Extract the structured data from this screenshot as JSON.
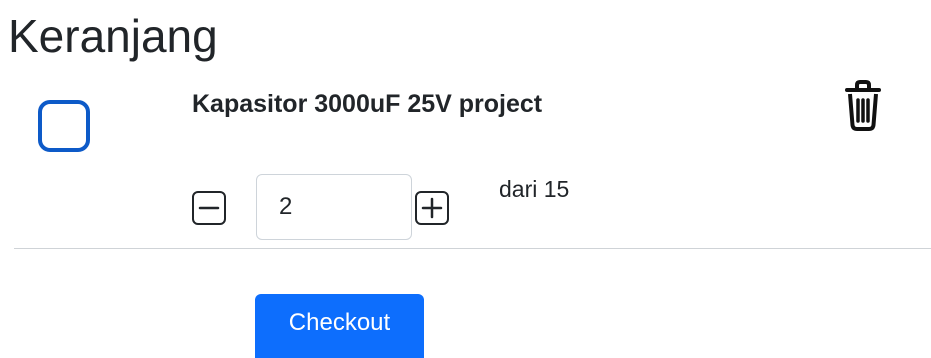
{
  "page": {
    "title": "Keranjang"
  },
  "cart": {
    "items": [
      {
        "name": "Kapasitor 3000uF 25V project",
        "selected": false,
        "quantity": "2",
        "stock_text": "dari 15"
      }
    ]
  },
  "actions": {
    "checkout_label": "Checkout"
  },
  "icons": {
    "checkbox": "checkbox-icon",
    "delete": "trash-icon",
    "decrement": "minus-icon",
    "increment": "plus-icon"
  },
  "colors": {
    "accent": "#0d6efd",
    "checkbox_border": "#0d5ac8",
    "text": "#212529",
    "divider": "#cfd3d7"
  }
}
